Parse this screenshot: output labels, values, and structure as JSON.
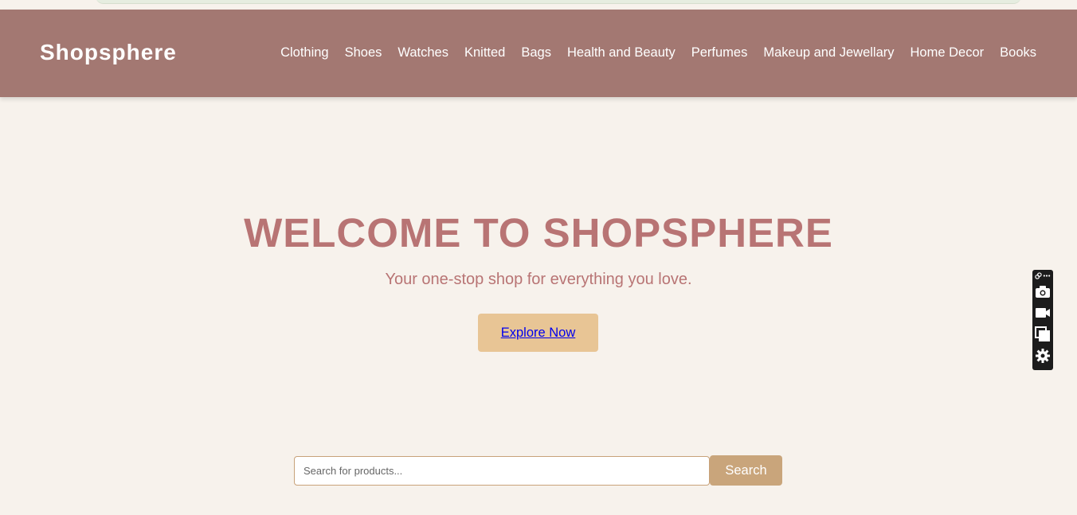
{
  "header": {
    "brand": "Shopsphere",
    "nav": [
      "Clothing",
      "Shoes",
      "Watches",
      "Knitted",
      "Bags",
      "Health and Beauty",
      "Perfumes",
      "Makeup and Jewellary",
      "Home Decor",
      "Books"
    ]
  },
  "hero": {
    "title": "WELCOME TO SHOPSPHERE",
    "subtitle": "Your one-stop shop for everything you love.",
    "cta": "Explore Now"
  },
  "search": {
    "placeholder": "Search for products...",
    "value": "",
    "button": "Search"
  },
  "toolbar": {
    "icons": [
      "link-icon",
      "more-icon",
      "camera-icon",
      "video-icon",
      "copy-icon",
      "gear-icon"
    ]
  },
  "colors": {
    "header_bg": "#a37872",
    "page_bg": "#f7f2ec",
    "title": "#b87474",
    "cta_bg": "#e8c595",
    "search_btn": "#c9a57b"
  }
}
